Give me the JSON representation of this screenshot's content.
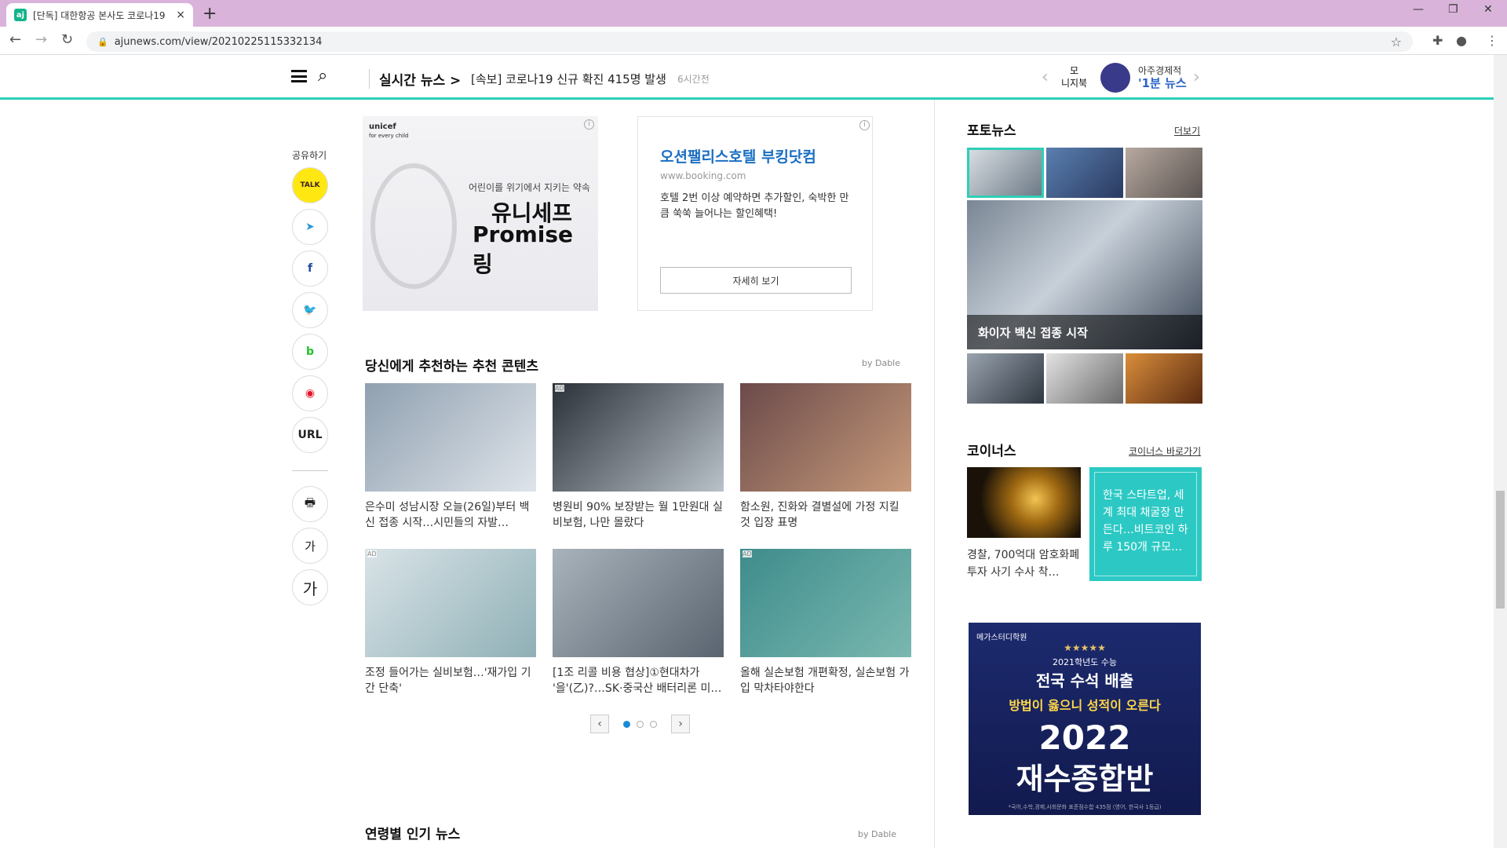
{
  "browser": {
    "tab_title": "[단독] 대한항공 본사도 코로나19",
    "favicon_text": "aj",
    "new_tab": "+",
    "close": "×",
    "url": "ajunews.com/view/20210225115332134"
  },
  "header": {
    "realtime_label": "실시간 뉴스 >",
    "realtime_headline": "[속보] 코로나19 신규 확진 415명 발생",
    "realtime_time": "6시간전",
    "mo_line1": "모",
    "mo_line2": "니지북",
    "brand_line1": "아주경제적",
    "brand_line2": "'1분 뉴스"
  },
  "share": {
    "label": "공유하기",
    "buttons": [
      {
        "name": "kakaotalk",
        "text": "TALK",
        "color": "#3c1e1e",
        "bg": "#ffe812"
      },
      {
        "name": "telegram",
        "text": "➤",
        "color": "#2a9ad8",
        "bg": "#fff"
      },
      {
        "name": "facebook",
        "text": "f",
        "color": "#1f4a9c",
        "bg": "#fff"
      },
      {
        "name": "twitter",
        "text": "🐦",
        "color": "#1da1f2",
        "bg": "#fff"
      },
      {
        "name": "band",
        "text": "b",
        "color": "#22c22e",
        "bg": "#fff"
      },
      {
        "name": "weibo",
        "text": "◉",
        "color": "#e6162d",
        "bg": "#fff"
      },
      {
        "name": "url",
        "text": "URL",
        "color": "#222",
        "bg": "#fff"
      }
    ],
    "tools": [
      {
        "name": "print",
        "text": "🖶"
      },
      {
        "name": "font-smaller",
        "text": "가"
      },
      {
        "name": "font-larger",
        "text": "가"
      }
    ]
  },
  "ads": {
    "unicef_logo": "unicef",
    "unicef_logo_sub": "for every child",
    "unicef_sub": "어린이를 위기에서 지키는 약속",
    "unicef_title": "유니세프",
    "unicef_promise": "Promise 링",
    "booking_title": "오션팰리스호텔 부킹닷컴",
    "booking_domain": "www.booking.com",
    "booking_desc": "호텔 2번 이상 예약하면 추가할인, 숙박한 만큼 쑥쑥 늘어나는 할인혜택!",
    "booking_button": "자세히 보기",
    "info": "i"
  },
  "recommend": {
    "title": "당신에게 추천하는 추천 콘텐츠",
    "by": "by Dable",
    "items": [
      {
        "caption": "은수미 성남시장 오늘(26일)부터 백신 접종 시작…시민들의 자발…",
        "ad": "",
        "c1": "#8fa0b0",
        "c2": "#dfe4ea"
      },
      {
        "caption": "병원비 90% 보장받는 월 1만원대 실비보험, 나만 몰랐다",
        "ad": "AD",
        "c1": "#2b3138",
        "c2": "#b9c1c9"
      },
      {
        "caption": "함소원, 진화와 결별설에 가정 지킬 것 입장 표명",
        "ad": "",
        "c1": "#6b4a4a",
        "c2": "#c79a7a"
      },
      {
        "caption": "조정 들어가는 실비보험…'재가입 기간 단축'",
        "ad": "AD",
        "c1": "#d9e3e7",
        "c2": "#8fb0b6"
      },
      {
        "caption": "[1조 리콜 비용 협상]①현대차가 '을'(乙)?…SK·중국산 배터리론 미…",
        "ad": "",
        "c1": "#a9b3bb",
        "c2": "#5a6470"
      },
      {
        "caption": "올해 실손보험 개편확정, 실손보험 가입 막차타야한다",
        "ad": "AD",
        "c1": "#3e8c8c",
        "c2": "#7ab8b0"
      }
    ],
    "prev": "‹",
    "next": "›"
  },
  "age_news": {
    "title": "연령별 인기 뉴스",
    "by": "by Dable"
  },
  "photo_news": {
    "title": "포토뉴스",
    "more": "더보기",
    "main_caption": "화이자 백신 접종 시작"
  },
  "coinus": {
    "title": "코이너스",
    "more": "코이너스 바로가기",
    "caption": "경찰, 700억대 암호화폐 투자 사기 수사 착…",
    "box_text": "한국 스타트업, 세계 최대 채굴장 만든다…비트코인 하루 150개 규모…"
  },
  "mega_ad": {
    "brand": "메가스터디학원",
    "stars": "★★★★★",
    "line1": "2021학년도 수능",
    "line2": "전국 수석 배출",
    "line3": "방법이 옳으니 성적이 오른다",
    "line4": "2022",
    "line5": "재수종합반",
    "footnote": "*국어,수학,경제,사회문화 표준점수합 435점 (영어, 한국사 1등급)"
  }
}
